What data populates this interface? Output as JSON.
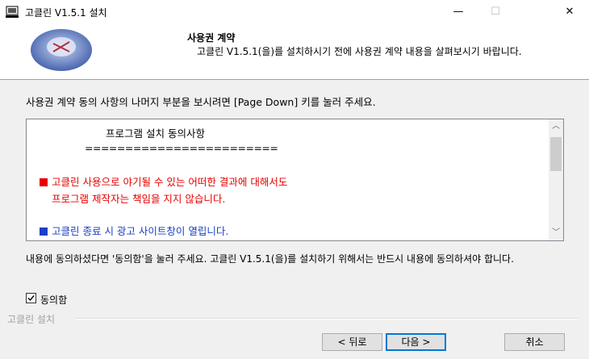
{
  "window": {
    "title": "고클린 V1.5.1 설치",
    "controls": {
      "minimize": "—",
      "maximize": "☐",
      "close": "✕"
    }
  },
  "header": {
    "title": "사용권 계약",
    "subtitle": "고클린 V1.5.1(을)를 설치하시기 전에 사용권 계약 내용을 살펴보시기 바랍니다."
  },
  "instruction": "사용권 계약 동의 사항의 나머지 부분을 보시려면 [Page Down] 키를 눌러 주세요.",
  "license": {
    "heading": "프로그램 설치 동의사항",
    "divider": "========================",
    "item1_line1": "고클린 사용으로 야기될 수 있는 어떠한 결과에 대해서도",
    "item1_line2": "프로그램 제작자는 책임을 지지 않습니다.",
    "item2": "고클린 종료 시 광고 사이트창이 열립니다.",
    "colors": {
      "warning": "#e60000",
      "info": "#1a3fc4"
    }
  },
  "accept_text": "내용에 동의하셨다면 '동의함'을 눌러 주세요. 고클린 V1.5.1(을)를 설치하기 위해서는 반드시 내용에 동의하셔야 합니다.",
  "agree": {
    "label": "동의함",
    "checked": true
  },
  "branding": "고클린 설치",
  "buttons": {
    "back": "< 뒤로",
    "next": "다음 >",
    "cancel": "취소"
  }
}
